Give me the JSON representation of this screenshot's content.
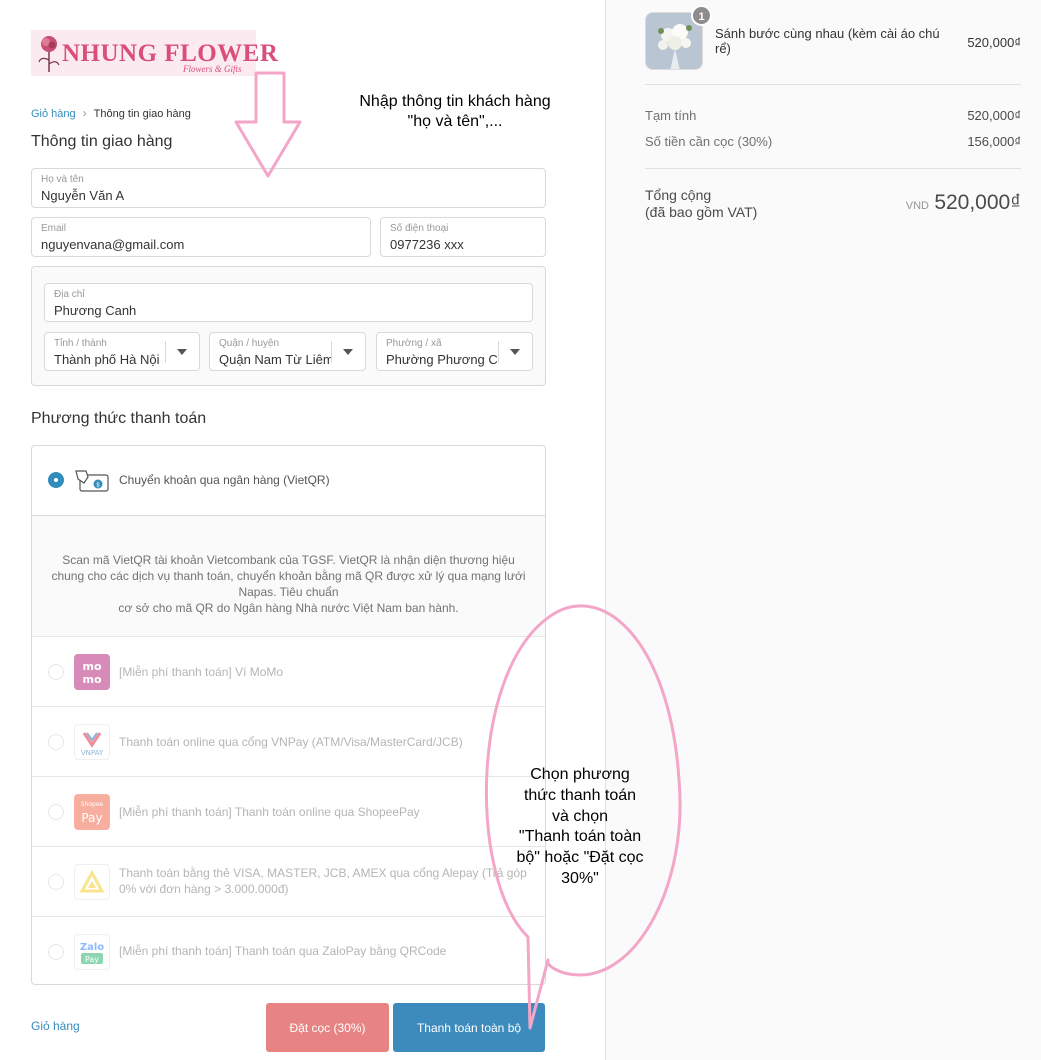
{
  "store": {
    "logo_name": "NHUNG FLOWER",
    "logo_tagline": "Flowers & Gifts"
  },
  "breadcrumb": {
    "cart": "Giỏ hàng",
    "current": "Thông tin giao hàng"
  },
  "shipping": {
    "title": "Thông tin giao hàng",
    "fullname": {
      "label": "Họ và tên",
      "value": "Nguyễn Văn A"
    },
    "email": {
      "label": "Email",
      "value": "nguyenvana@gmail.com"
    },
    "phone": {
      "label": "Số điện thoại",
      "value": "0977236 xxx"
    },
    "address": {
      "label": "Địa chỉ",
      "value": "Phương Canh"
    },
    "province": {
      "label": "Tỉnh / thành",
      "value": "Thành phố Hà Nội"
    },
    "district": {
      "label": "Quận / huyện",
      "value": "Quận Nam Từ Liêm"
    },
    "ward": {
      "label": "Phường / xã",
      "value": "Phường Phương C"
    }
  },
  "payment": {
    "title": "Phương thức thanh toán",
    "selected": {
      "label": "Chuyển khoản qua ngân hàng (VietQR)",
      "icon": "bank-transfer-icon",
      "description_1": "Scan mã VietQR tài khoản Vietcombank của TGSF. VietQR là nhận diện thương hiệu chung cho các dịch vụ thanh toán, chuyển khoản bằng mã QR được xử lý qua mạng lưới Napas. Tiêu chuẩn",
      "description_2": "cơ sở cho mã QR do Ngân hàng Nhà nước Việt Nam ban hành."
    },
    "methods": [
      {
        "label": "[Miễn phí thanh toán] Ví MoMo",
        "icon": "momo-logo",
        "color": "#a50064"
      },
      {
        "label": "Thanh toán online qua cổng VNPay (ATM/Visa/MasterCard/JCB)",
        "icon": "vnpay-logo",
        "color": "#005baa"
      },
      {
        "label": "[Miễn phí thanh toán] Thanh toán online qua ShopeePay",
        "icon": "shopeepay-logo",
        "color": "#ee4d2d"
      },
      {
        "label": "Thanh toán bằng thẻ VISA, MASTER, JCB, AMEX qua cổng Alepay (Trả góp 0% với đơn hàng > 3.000.000đ)",
        "icon": "alepay-logo",
        "color": "#f5c400"
      },
      {
        "label": "[Miễn phí thanh toán] Thanh toán qua ZaloPay bằng QRCode",
        "icon": "zalopay-logo",
        "color": "#00a651"
      }
    ]
  },
  "actions": {
    "back_to_cart": "Giỏ hàng",
    "deposit": "Đặt cọc (30%)",
    "pay_full": "Thanh toán toàn bộ"
  },
  "order": {
    "quantity": "1",
    "product_name": "Sánh bước cùng nhau (kèm cài áo chú rể)",
    "product_price": "520,000₫",
    "subtotal_label": "Tạm tính",
    "subtotal_value": "520,000₫",
    "deposit_label": "Số tiền cần cọc (30%)",
    "deposit_value": "156,000₫",
    "total_label": "Tổng cộng",
    "total_note": "(đã bao gồm VAT)",
    "currency": "VND",
    "total_value": "520,000₫"
  },
  "annotations": {
    "top_line1": "Nhập thông tin khách hàng",
    "top_line2": "\"họ và tên\",...",
    "bubble_line1": "Chọn phương",
    "bubble_line2": "thức thanh toán",
    "bubble_line3": "và chọn",
    "bubble_line4": "\"Thanh toán toàn",
    "bubble_line5": "bộ\" hoặc \"Đặt cọc",
    "bubble_line6": "30%\""
  },
  "colors": {
    "accent": "#338dbc",
    "deposit_button": "#e88383",
    "full_button": "#3d8bbd",
    "annotation": "#f4a6c8",
    "brand": "#d94f7a"
  }
}
